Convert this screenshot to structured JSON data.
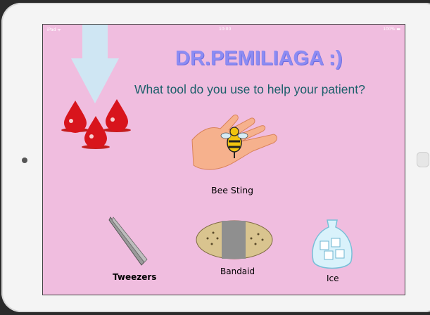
{
  "device": {
    "status_left": "iPad ᯤ",
    "status_time": "10:00",
    "status_battery": "100% ▬"
  },
  "screen": {
    "title": "DR.PEMILIAGA :)",
    "question": "What tool do you use to help your patient?",
    "patient_label": "Bee Sting",
    "tools": [
      {
        "label": "Tweezers",
        "icon": "tweezers-icon"
      },
      {
        "label": "Bandaid",
        "icon": "bandaid-icon"
      },
      {
        "label": "Ice",
        "icon": "ice-bag-icon"
      }
    ]
  },
  "colors": {
    "background": "#f0bddf",
    "title": "#8c8cf3",
    "question": "#1b5f6a"
  }
}
